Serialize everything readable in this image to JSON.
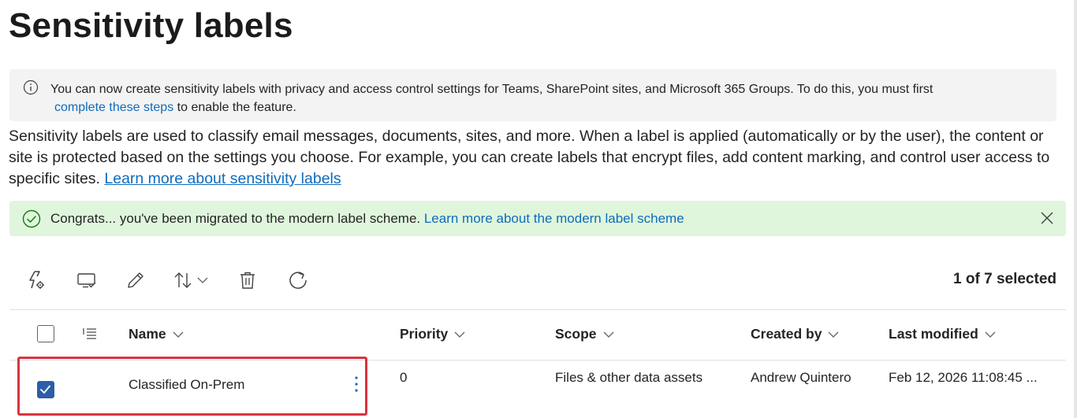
{
  "page": {
    "title": "Sensitivity labels"
  },
  "info_banner": {
    "icon": "info-icon",
    "text_line1": "You can now create sensitivity labels with privacy and access control settings for Teams, SharePoint sites, and Microsoft 365 Groups. To do this, you must first",
    "link_text": "complete these steps",
    "text_line2_suffix": " to enable the feature."
  },
  "description": {
    "text": "Sensitivity labels are used to classify email messages, documents, sites, and more. When a label is applied (automatically or by the user), the content or site is protected based on the settings you choose. For example, you can create labels that encrypt files, add content marking, and control user access to specific sites. ",
    "link_text": "Learn more about sensitivity labels"
  },
  "success_banner": {
    "icon": "check-circle-icon",
    "text": "Congrats... you've been migrated to the modern label scheme. ",
    "link_text": "Learn more about the modern label scheme",
    "close_icon": "close-icon"
  },
  "toolbar": {
    "buttons": [
      {
        "name": "label-policies-button",
        "icon": "flash-gear-icon"
      },
      {
        "name": "publish-button",
        "icon": "monitor-check-icon"
      },
      {
        "name": "edit-button",
        "icon": "pencil-icon"
      },
      {
        "name": "sort-button",
        "icon": "sort-arrows-icon"
      },
      {
        "name": "delete-button",
        "icon": "trash-icon"
      },
      {
        "name": "refresh-button",
        "icon": "refresh-icon"
      }
    ],
    "selection_status": "1 of 7 selected"
  },
  "table": {
    "columns": [
      "Name",
      "Priority",
      "Scope",
      "Created by",
      "Last modified"
    ],
    "rows": [
      {
        "selected": true,
        "name": "Classified On-Prem",
        "priority": "0",
        "scope": "Files & other data assets",
        "created_by": "Andrew Quintero",
        "last_modified": "Feb 12, 2026 11:08:45 ..."
      }
    ]
  },
  "colors": {
    "accent": "#0f6cbd",
    "success_bg": "#dff6dd",
    "success_icon": "#107c10",
    "info_bg": "#f3f3f3",
    "checkbox_checked": "#2b5ea7",
    "highlight": "#d8333e"
  }
}
